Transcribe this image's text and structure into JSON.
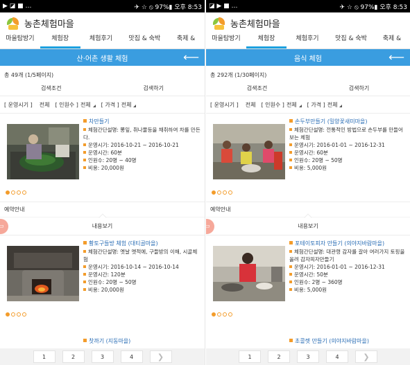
{
  "colors": {
    "accent": "#3a9de0",
    "tab_underline": "#1da1e0",
    "bullet": "#f39c2b",
    "title": "#2a6db5"
  },
  "left": {
    "status": {
      "left": "▶ ◪ ■ …",
      "right": "✈ ☆ ⦸ 97%▮ 오후 8:53"
    },
    "app_title": "농촌체험마을",
    "tabs": [
      "마을탐방기",
      "체험장",
      "체험후기",
      "맛집 & 숙박",
      "축제 &"
    ],
    "active_tab": 1,
    "banner": "산·어촌 생활 체험",
    "count": "총 49개 (1/5페이지)",
    "search_condition": "검색조건",
    "search_button": "검색하기",
    "filters": {
      "period_label": "[ 운영시기 ]",
      "period_value": "전체",
      "people_label": "[ 인원수 ]",
      "people_value": "전체",
      "price_label": "[ 가격 ]",
      "price_value": "전체"
    },
    "item1": {
      "title": "차만들기",
      "desc": "체험간단설명: 뽕잎, 취나물등을 채취하여 차를 만든다.",
      "period": "운영시기: 2016-10-21 ~ 2016-10-21",
      "time": "운영시간: 60분",
      "people": "인원수: 20명 ~ 40명",
      "cost": "비용: 20,000원"
    },
    "reservation": "예약안내",
    "view_more": "내용보기",
    "item2": {
      "title": "황토구들방 체험 (대티골마을)",
      "desc": "체험간단설명: 옛날 옛적에, 구들방의 이해, 시골체험",
      "period": "운영시기: 2016-10-14 ~ 2016-10-14",
      "time": "운영시간: 120분",
      "people": "인원수: 20명 ~ 50명",
      "cost": "비용: 20,000원"
    },
    "next_title": "찻까기 (지동마을)",
    "pages": [
      "1",
      "2",
      "3",
      "4"
    ]
  },
  "right": {
    "status": {
      "left": "◪ ▶ ■ …",
      "right": "✈ ☆ ⦸ 97%▮ 오후 8:53"
    },
    "app_title": "농촌체험마을",
    "tabs": [
      "마을탐방기",
      "체험장",
      "체험후기",
      "맛집 & 숙박",
      "축제 &"
    ],
    "active_tab": 1,
    "banner": "음식 체험",
    "count": "총 292개 (1/30페이지)",
    "search_condition": "검색조건",
    "search_button": "검색하기",
    "filters": {
      "period_label": "[ 운영시기 ]",
      "period_value": "전체",
      "people_label": "[ 인원수 ]",
      "people_value": "전체",
      "price_label": "[ 가격 ]",
      "price_value": "전체"
    },
    "item1": {
      "title": "손두부만들기 (밀양꽃새미마을)",
      "desc": "체험간단설명: 전통적인 방법으로 손두부를 만들어 보는 체험",
      "period": "운영시기: 2016-01-01 ~ 2016-12-31",
      "time": "운영시간: 60분",
      "people": "인원수: 20명 ~ 50명",
      "cost": "비용: 5,000원"
    },
    "reservation": "예약안내",
    "view_more": "내용보기",
    "item2": {
      "title": "포테이토피자 만들기 (의야지바람마을)",
      "desc": "체험간단설명: 대관령 감자를 갈아 여러가지 토핑을 올려 감자피자만들기",
      "period": "운영시기: 2016-01-01 ~ 2016-12-31",
      "time": "운영시간: 50분",
      "people": "인원수: 2명 ~ 360명",
      "cost": "비용: 5,000원"
    },
    "next_title": "초콜렛 만들기 (의야지바람마을)",
    "pages": [
      "1",
      "2",
      "3",
      "4"
    ]
  }
}
